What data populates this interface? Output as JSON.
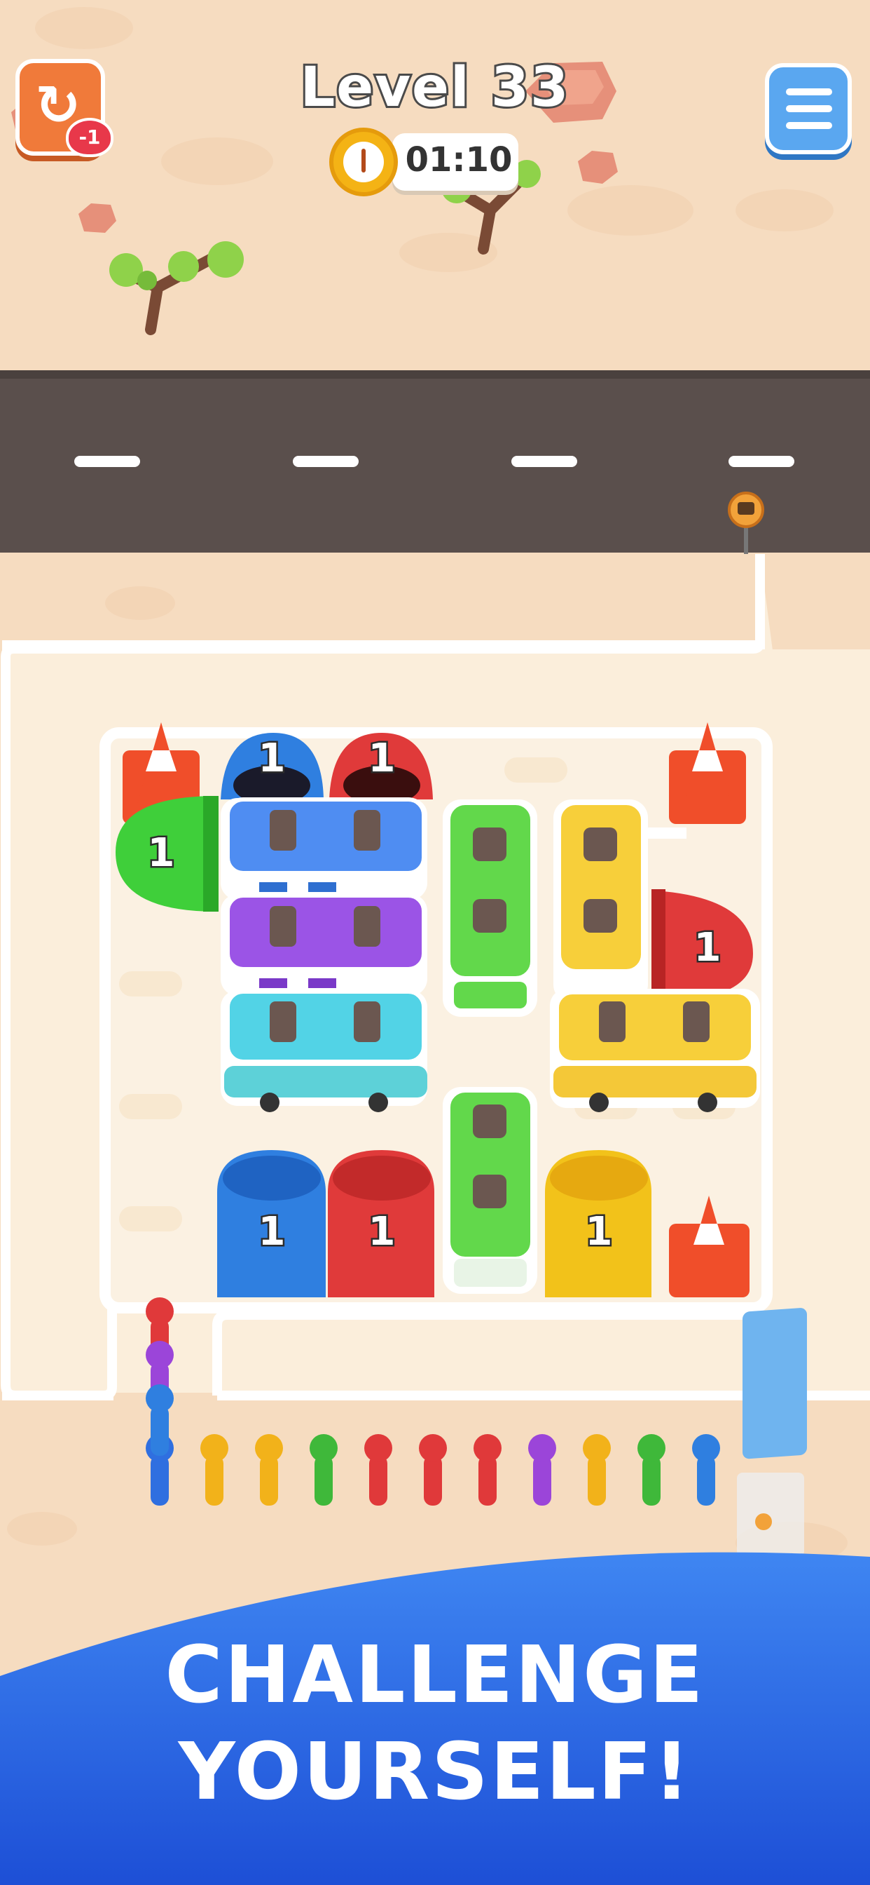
{
  "hud": {
    "level_label": "Level 33",
    "timer": "01:10",
    "undo_badge": "-1"
  },
  "banner": {
    "line1": "CHALLENGE",
    "line2": "YOURSELF!"
  },
  "board": {
    "buses": [
      {
        "id": "blue",
        "color": "#4f8df2",
        "seats": 2,
        "label": ""
      },
      {
        "id": "purple",
        "color": "#9b54e6",
        "seats": 2,
        "label": ""
      },
      {
        "id": "cyan",
        "color": "#52d3e6",
        "seats": 2,
        "label": ""
      },
      {
        "id": "green-top",
        "color": "#62d84b",
        "seats": 2,
        "label": ""
      },
      {
        "id": "yellow-top",
        "color": "#f7cf3a",
        "seats": 2,
        "label": ""
      },
      {
        "id": "yellow-side",
        "color": "#f7cf3a",
        "seats": 2,
        "label": ""
      },
      {
        "id": "green-bottom",
        "color": "#62d84b",
        "seats": 2,
        "label": ""
      }
    ],
    "cars": [
      {
        "color": "#2f7fe0",
        "count": "1"
      },
      {
        "color": "#e03a3a",
        "count": "1"
      },
      {
        "color": "#3fcf3a",
        "count": "1"
      },
      {
        "color": "#e03a3a",
        "count": "1"
      },
      {
        "color": "#2f7fe0",
        "count": "1"
      },
      {
        "color": "#e03a3a",
        "count": "1"
      },
      {
        "color": "#f2c21a",
        "count": "1"
      }
    ],
    "queue_colors": [
      "#2f6fe0",
      "#f2b21a",
      "#f2b21a",
      "#3fb83a",
      "#e0393a",
      "#e0393a",
      "#e0393a",
      "#9b45d9",
      "#f2b21a",
      "#3fb83a",
      "#2f7fe0"
    ],
    "queue_stack_colors": [
      "#e0393a",
      "#9b45d9",
      "#2f7fe0"
    ]
  },
  "colors": {
    "road": "#5a4f4c",
    "sand": "#f6dcc0",
    "board_bg": "#fbeedb",
    "banner_blue": "#2d6be6"
  }
}
